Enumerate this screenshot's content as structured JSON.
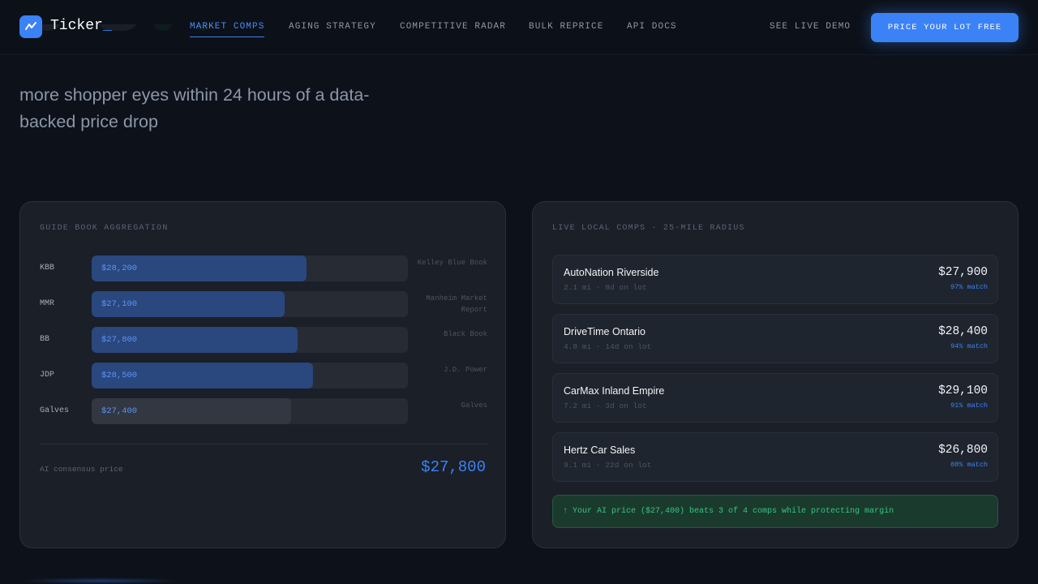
{
  "nav": {
    "logo": "Ticker",
    "logo_cursor": "_",
    "links": [
      "MARKET COMPS",
      "AGING STRATEGY",
      "COMPETITIVE RADAR",
      "BULK REPRICE",
      "API DOCS"
    ],
    "active_link": "MARKET COMPS",
    "demo_link": "SEE LIVE DEMO",
    "cta": "PRICE YOUR LOT FREE"
  },
  "hero": {
    "subtitle": "more shopper eyes within 24 hours of a data-backed price drop"
  },
  "guide_books": {
    "title": "GUIDE BOOK AGGREGATION",
    "rows": [
      {
        "abbr": "KBB",
        "value": "$28,200",
        "name": "Kelley Blue Book",
        "fill": 0.68,
        "highlight": true
      },
      {
        "abbr": "MMR",
        "value": "$27,100",
        "name": "Manheim Market Report",
        "fill": 0.61,
        "highlight": true
      },
      {
        "abbr": "BB",
        "value": "$27,800",
        "name": "Black Book",
        "fill": 0.65,
        "highlight": true
      },
      {
        "abbr": "JDP",
        "value": "$28,500",
        "name": "J.D. Power",
        "fill": 0.7,
        "highlight": true
      },
      {
        "abbr": "Galves",
        "value": "$27,400",
        "name": "Galves",
        "fill": 0.63,
        "highlight": false
      }
    ],
    "consensus_label": "AI consensus price",
    "consensus_value": "$27,800"
  },
  "local_comps": {
    "title": "LIVE LOCAL COMPS · 25-MILE RADIUS",
    "comps": [
      {
        "name": "AutoNation Riverside",
        "meta": "2.1 mi · 8d on lot",
        "price": "$27,900",
        "match": "97% match"
      },
      {
        "name": "DriveTime Ontario",
        "meta": "4.8 mi · 14d on lot",
        "price": "$28,400",
        "match": "94% match"
      },
      {
        "name": "CarMax Inland Empire",
        "meta": "7.2 mi · 3d on lot",
        "price": "$29,100",
        "match": "91% match"
      },
      {
        "name": "Hertz Car Sales",
        "meta": "9.1 mi · 22d on lot",
        "price": "$26,800",
        "match": "88% match"
      }
    ],
    "banner": "↑ Your AI price ($27,400) beats 3 of 4 comps while protecting margin"
  },
  "colors": {
    "accent": "#3b82f6",
    "success": "#34c77b",
    "background": "#0d111a",
    "card": "#1a1f28"
  },
  "icons": {
    "logo": "trend-line-icon"
  }
}
